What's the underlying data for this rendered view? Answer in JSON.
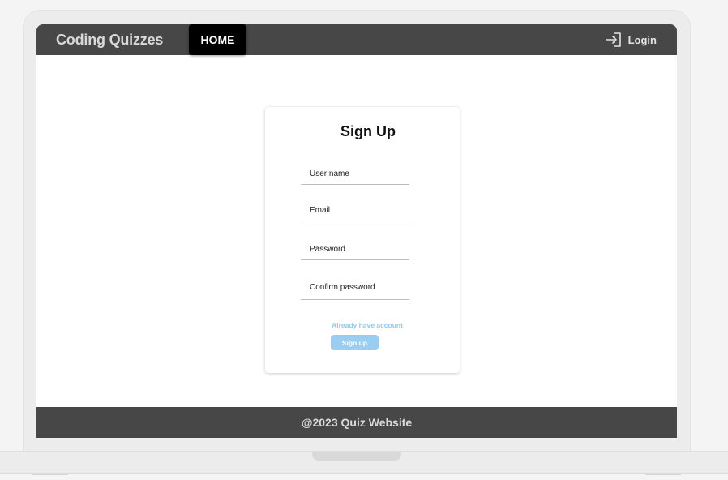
{
  "navbar": {
    "brand": "Coding Quizzes",
    "home_label": "HOME",
    "login_label": "Login",
    "login_icon": "login-icon"
  },
  "signup_form": {
    "title": "Sign Up",
    "fields": {
      "username": {
        "placeholder": "User name",
        "value": ""
      },
      "email": {
        "placeholder": "Email",
        "value": ""
      },
      "password": {
        "placeholder": "Password",
        "value": ""
      },
      "confirm_password": {
        "placeholder": "Confirm password",
        "value": ""
      }
    },
    "account_link": "Already have account",
    "submit_label": "Sign up"
  },
  "footer": {
    "text": "@2023 Quiz Website"
  },
  "colors": {
    "navbar_bg": "#474747",
    "home_active_bg": "#000000",
    "accent_link": "#90c8ec",
    "button_bg": "#9acdf2",
    "page_bg": "#ffffff"
  }
}
